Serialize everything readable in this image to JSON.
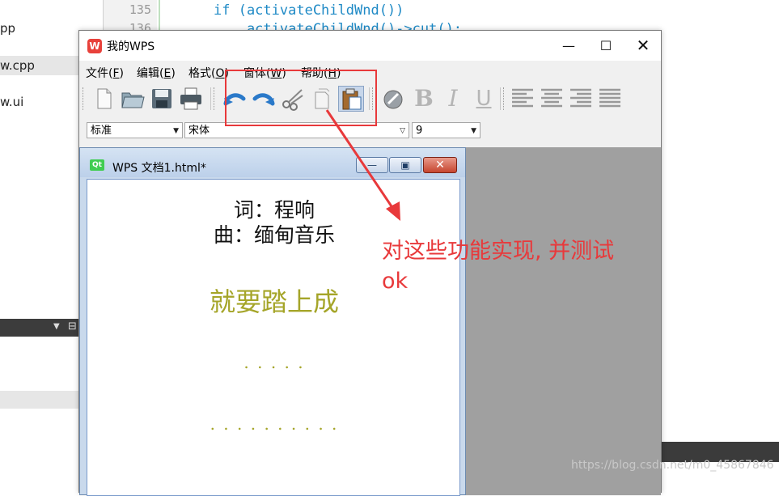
{
  "ide": {
    "files": [
      "pp",
      "w.cpp",
      "w.ui"
    ],
    "line_numbers": [
      "135",
      "136"
    ],
    "code_lines": [
      "if (activateChildWnd())",
      "    activateChildWnd()->cut();"
    ],
    "watermark": "https://blog.csdn.net/m0_45867846"
  },
  "window": {
    "title": "我的WPS",
    "icon_glyph": "W",
    "controls": {
      "minimize": "—",
      "maximize": "☐",
      "close": "✕"
    }
  },
  "menubar": [
    {
      "label": "文件(",
      "key": "F",
      "end": ")"
    },
    {
      "label": "编辑(",
      "key": "E",
      "end": ")"
    },
    {
      "label": "格式(",
      "key": "O",
      "end": ")"
    },
    {
      "label": "窗体(",
      "key": "W",
      "end": ")"
    },
    {
      "label": "帮助(",
      "key": "H",
      "end": ")"
    }
  ],
  "toolbar": {
    "icons": [
      "new-file-icon",
      "open-folder-icon",
      "save-disk-icon",
      "print-icon",
      "undo-icon",
      "redo-icon",
      "cut-scissors-icon",
      "copy-icon",
      "paste-icon",
      "color-icon",
      "bold-icon",
      "italic-icon",
      "underline-icon",
      "align-left-icon",
      "align-center-icon",
      "align-right-icon",
      "justify-icon"
    ],
    "bold": "B",
    "italic": "I",
    "underline": "U"
  },
  "formatbar": {
    "style": "标准",
    "font": "宋体",
    "size": "9"
  },
  "child": {
    "title": "WPS 文档1.html*",
    "icon_label": "Qt",
    "controls": {
      "minimize": "—",
      "restore": "▣",
      "close": "✕"
    }
  },
  "document": {
    "lines": [
      "词：程响",
      "曲：缅甸音乐",
      "就要踏上成",
      ". . . . .",
      ". . . . . . . . . ."
    ],
    "accent_color": "#a5a529"
  },
  "annotation": {
    "text_line1": "对这些功能实现, 并测试",
    "text_line2": "ok",
    "color": "#e8393b"
  }
}
